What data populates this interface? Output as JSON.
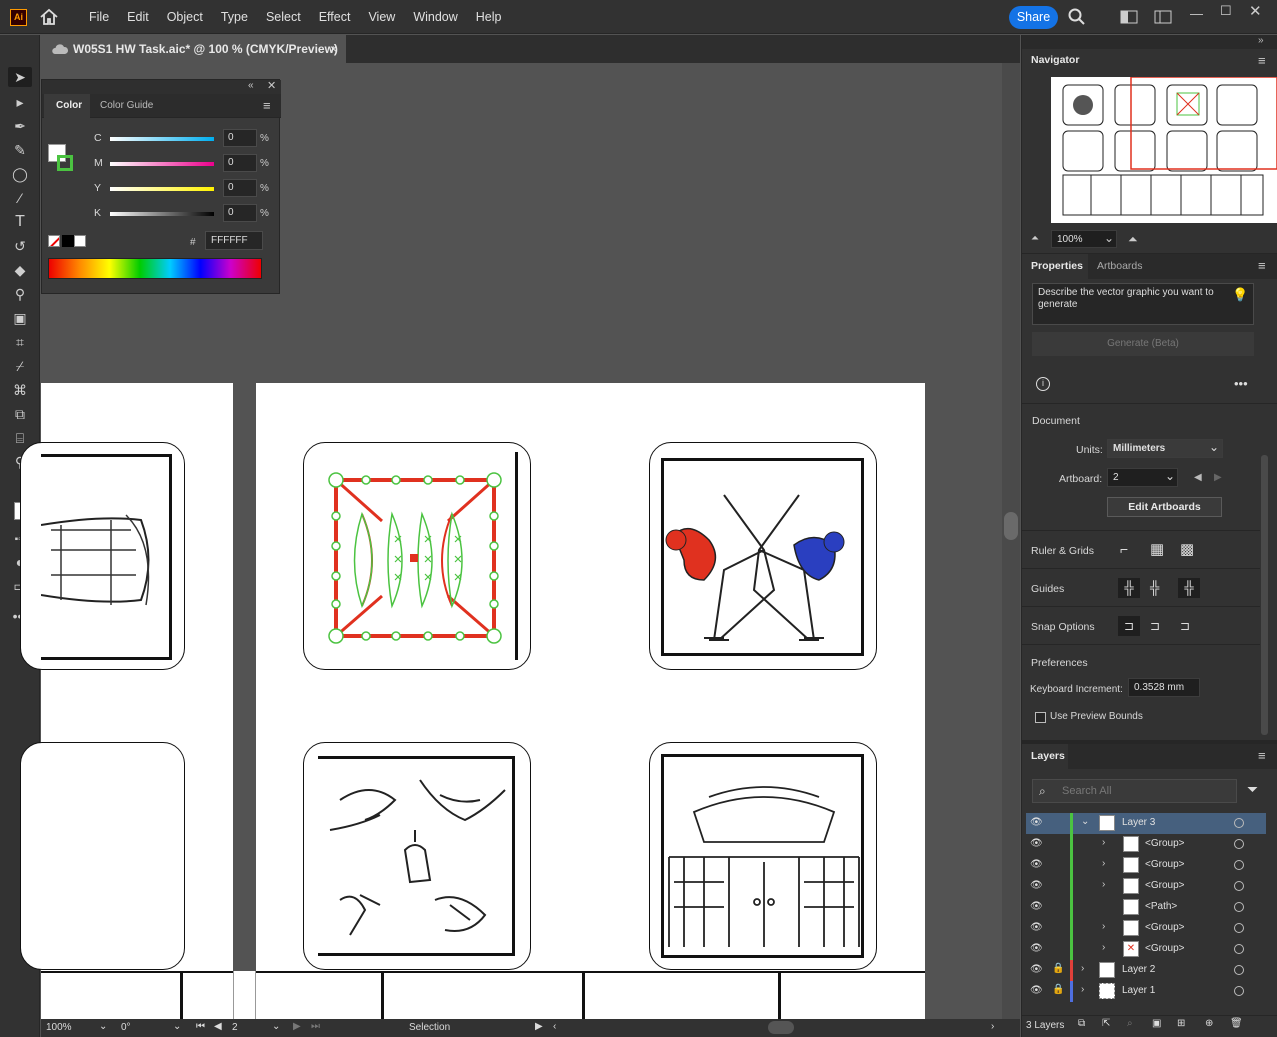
{
  "app": {
    "logo": "Ai",
    "home_icon": "home-icon"
  },
  "menu": [
    "File",
    "Edit",
    "Object",
    "Type",
    "Select",
    "Effect",
    "View",
    "Window",
    "Help"
  ],
  "share_label": "Share",
  "document_tab": {
    "title": "W05S1 HW Task.aic* @ 100 % (CMYK/Preview)",
    "close": "×"
  },
  "color_panel": {
    "tabs": [
      "Color",
      "Color Guide"
    ],
    "sliders": [
      {
        "label": "C",
        "value": "0"
      },
      {
        "label": "M",
        "value": "0"
      },
      {
        "label": "Y",
        "value": "0"
      },
      {
        "label": "K",
        "value": "0"
      }
    ],
    "pct": "%",
    "hash": "#",
    "hex": "FFFFFF"
  },
  "navigator": {
    "title": "Navigator",
    "zoom": "100%"
  },
  "properties": {
    "tabs": [
      "Properties",
      "Artboards"
    ],
    "prompt_placeholder": "Describe the vector graphic you want to generate",
    "generate_label": "Generate (Beta)",
    "document_heading": "Document",
    "units_label": "Units:",
    "units_value": "Millimeters",
    "artboard_label": "Artboard:",
    "artboard_value": "2",
    "edit_artboards": "Edit Artboards",
    "ruler_grids": "Ruler & Grids",
    "guides": "Guides",
    "snap_options": "Snap Options",
    "preferences": "Preferences",
    "keyboard_increment_label": "Keyboard Increment:",
    "keyboard_increment_value": "0.3528 mm",
    "use_preview_bounds": "Use Preview Bounds"
  },
  "layers": {
    "title": "Layers",
    "search_placeholder": "Search All",
    "rows": [
      {
        "name": "Layer 3",
        "color": "#4bc341"
      },
      {
        "name": "<Group>",
        "color": "#4bc341"
      },
      {
        "name": "<Group>",
        "color": "#4bc341"
      },
      {
        "name": "<Group>",
        "color": "#4bc341"
      },
      {
        "name": "<Path>",
        "color": "#4bc341"
      },
      {
        "name": "<Group>",
        "color": "#4bc341"
      },
      {
        "name": "<Group>",
        "color": "#4bc341"
      },
      {
        "name": "Layer 2",
        "color": "#e0403a"
      },
      {
        "name": "Layer 1",
        "color": "#4f6fe0"
      }
    ],
    "count": "3 Layers"
  },
  "status": {
    "zoom": "100%",
    "rotation": "0°",
    "artboard": "2",
    "tool": "Selection"
  }
}
